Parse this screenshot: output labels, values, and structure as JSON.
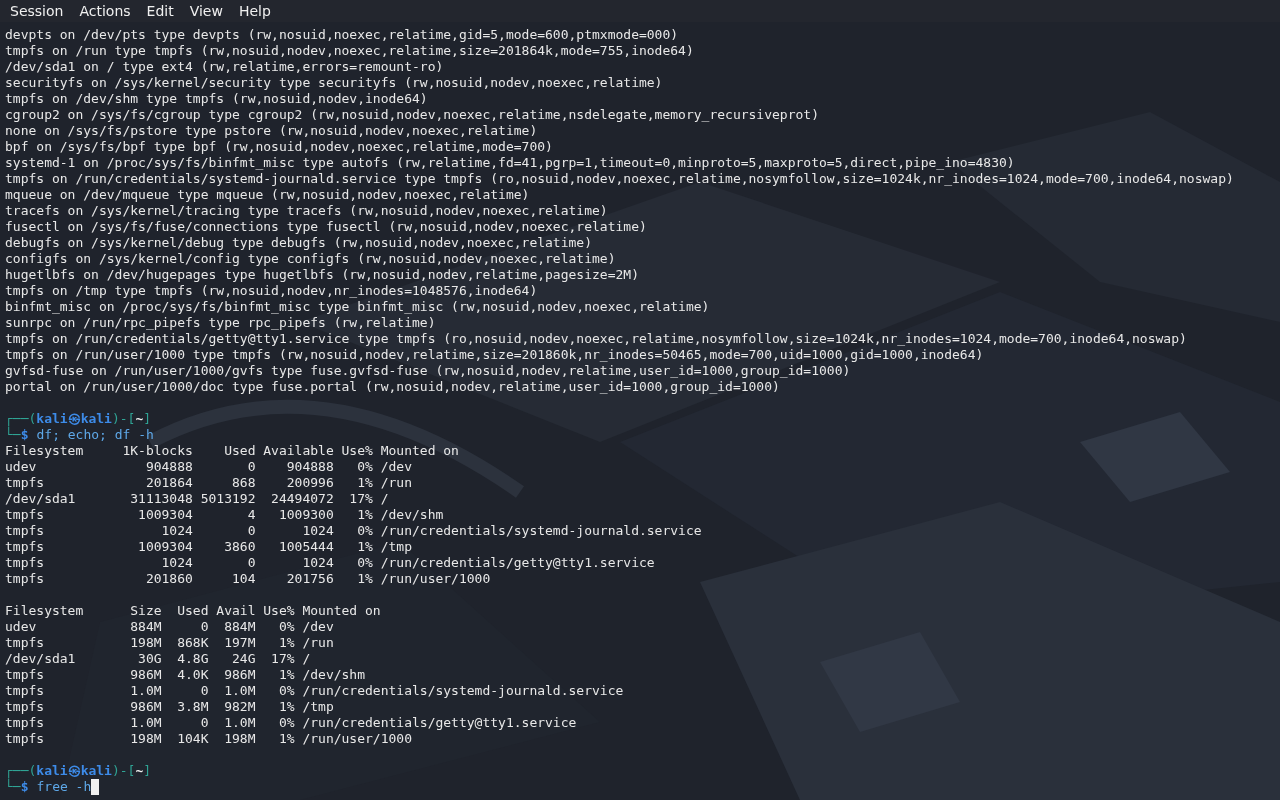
{
  "menu": [
    "Session",
    "Actions",
    "Edit",
    "View",
    "Help"
  ],
  "blocks": [
    {
      "kind": "output",
      "lines": [
        "devpts on /dev/pts type devpts (rw,nosuid,noexec,relatime,gid=5,mode=600,ptmxmode=000)",
        "tmpfs on /run type tmpfs (rw,nosuid,nodev,noexec,relatime,size=201864k,mode=755,inode64)",
        "/dev/sda1 on / type ext4 (rw,relatime,errors=remount-ro)",
        "securityfs on /sys/kernel/security type securityfs (rw,nosuid,nodev,noexec,relatime)",
        "tmpfs on /dev/shm type tmpfs (rw,nosuid,nodev,inode64)",
        "cgroup2 on /sys/fs/cgroup type cgroup2 (rw,nosuid,nodev,noexec,relatime,nsdelegate,memory_recursiveprot)",
        "none on /sys/fs/pstore type pstore (rw,nosuid,nodev,noexec,relatime)",
        "bpf on /sys/fs/bpf type bpf (rw,nosuid,nodev,noexec,relatime,mode=700)",
        "systemd-1 on /proc/sys/fs/binfmt_misc type autofs (rw,relatime,fd=41,pgrp=1,timeout=0,minproto=5,maxproto=5,direct,pipe_ino=4830)",
        "tmpfs on /run/credentials/systemd-journald.service type tmpfs (ro,nosuid,nodev,noexec,relatime,nosymfollow,size=1024k,nr_inodes=1024,mode=700,inode64,noswap)",
        "mqueue on /dev/mqueue type mqueue (rw,nosuid,nodev,noexec,relatime)",
        "tracefs on /sys/kernel/tracing type tracefs (rw,nosuid,nodev,noexec,relatime)",
        "fusectl on /sys/fs/fuse/connections type fusectl (rw,nosuid,nodev,noexec,relatime)",
        "debugfs on /sys/kernel/debug type debugfs (rw,nosuid,nodev,noexec,relatime)",
        "configfs on /sys/kernel/config type configfs (rw,nosuid,nodev,noexec,relatime)",
        "hugetlbfs on /dev/hugepages type hugetlbfs (rw,nosuid,nodev,relatime,pagesize=2M)",
        "tmpfs on /tmp type tmpfs (rw,nosuid,nodev,nr_inodes=1048576,inode64)",
        "binfmt_misc on /proc/sys/fs/binfmt_misc type binfmt_misc (rw,nosuid,nodev,noexec,relatime)",
        "sunrpc on /run/rpc_pipefs type rpc_pipefs (rw,relatime)",
        "tmpfs on /run/credentials/getty@tty1.service type tmpfs (ro,nosuid,nodev,noexec,relatime,nosymfollow,size=1024k,nr_inodes=1024,mode=700,inode64,noswap)",
        "tmpfs on /run/user/1000 type tmpfs (rw,nosuid,nodev,relatime,size=201860k,nr_inodes=50465,mode=700,uid=1000,gid=1000,inode64)",
        "gvfsd-fuse on /run/user/1000/gvfs type fuse.gvfsd-fuse (rw,nosuid,nodev,relatime,user_id=1000,group_id=1000)",
        "portal on /run/user/1000/doc type fuse.portal (rw,nosuid,nodev,relatime,user_id=1000,group_id=1000)"
      ]
    },
    {
      "kind": "prompt",
      "open": "┌──(",
      "user": "kali",
      "at": "㉿",
      "host": "kali",
      "mid": ")-[",
      "dir": "~",
      "close": "]",
      "corner": "└─",
      "symbol": "$",
      "command": "df; echo; df -h",
      "cursor": false
    },
    {
      "kind": "output",
      "lines": [
        "Filesystem     1K-blocks    Used Available Use% Mounted on",
        "udev              904888       0    904888   0% /dev",
        "tmpfs             201864     868    200996   1% /run",
        "/dev/sda1       31113048 5013192  24494072  17% /",
        "tmpfs            1009304       4   1009300   1% /dev/shm",
        "tmpfs               1024       0      1024   0% /run/credentials/systemd-journald.service",
        "tmpfs            1009304    3860   1005444   1% /tmp",
        "tmpfs               1024       0      1024   0% /run/credentials/getty@tty1.service",
        "tmpfs             201860     104    201756   1% /run/user/1000"
      ]
    },
    {
      "kind": "output",
      "lines": [
        "Filesystem      Size  Used Avail Use% Mounted on",
        "udev            884M     0  884M   0% /dev",
        "tmpfs           198M  868K  197M   1% /run",
        "/dev/sda1        30G  4.8G   24G  17% /",
        "tmpfs           986M  4.0K  986M   1% /dev/shm",
        "tmpfs           1.0M     0  1.0M   0% /run/credentials/systemd-journald.service",
        "tmpfs           986M  3.8M  982M   1% /tmp",
        "tmpfs           1.0M     0  1.0M   0% /run/credentials/getty@tty1.service",
        "tmpfs           198M  104K  198M   1% /run/user/1000"
      ]
    },
    {
      "kind": "prompt",
      "open": "┌──(",
      "user": "kali",
      "at": "㉿",
      "host": "kali",
      "mid": ")-[",
      "dir": "~",
      "close": "]",
      "corner": "└─",
      "symbol": "$",
      "command": "free -h",
      "cursor": true
    }
  ]
}
